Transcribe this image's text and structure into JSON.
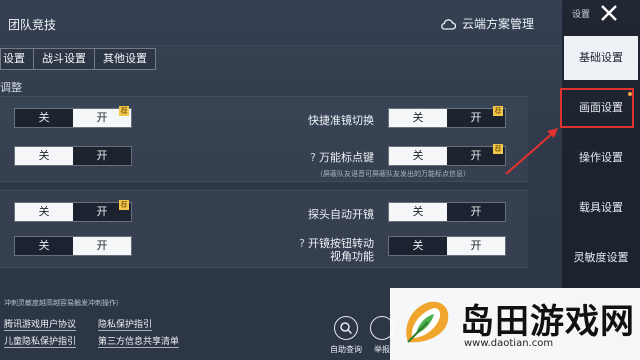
{
  "header": {
    "title": "团队竞技",
    "cloud_label": "云端方案管理"
  },
  "tabs": [
    "设置",
    "战斗设置",
    "其他设置"
  ],
  "section_label": "调整",
  "toggles": {
    "off": "关",
    "on": "开",
    "badge": "荐"
  },
  "settings": {
    "quick_scope": "快捷准镜切换",
    "universal_marker": "万能标点键",
    "universal_marker_note": "（屏蔽队友语音可屏蔽队友发出的万能标点信息）",
    "peek_auto_scope": "探头自动开镜",
    "scope_button_turn_line1": "开镜按钮转动",
    "scope_button_turn_line2": "视角功能",
    "help_mark": "?"
  },
  "bottom": {
    "note": "冲刺灵敏度越高越容易触发冲刺操作）",
    "links": [
      "腾讯游戏用户协议",
      "隐私保护指引",
      "儿童隐私保护指引",
      "第三方信息共享清单"
    ],
    "help_button": "自助查询",
    "report_button": "举报"
  },
  "sidebar": {
    "top_label": "设置",
    "items": [
      "基础设置",
      "画面设置",
      "操作设置",
      "载具设置",
      "灵敏度设置"
    ]
  },
  "watermark": {
    "title": "岛田游戏网",
    "url": "www.daotian.com"
  },
  "colors": {
    "highlight": "#e0322e",
    "badge": "#f2c94c"
  }
}
